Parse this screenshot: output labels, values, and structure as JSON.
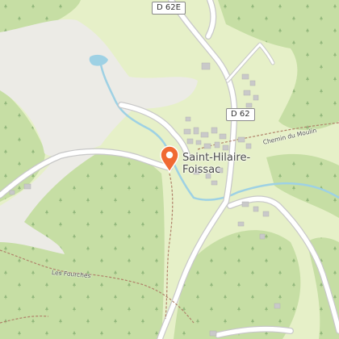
{
  "map": {
    "colors": {
      "forest": "#c6dea4",
      "meadow": "#e6f0c8",
      "open_area": "#ecebe6",
      "water": "#9ed1e4",
      "road_fill": "#ffffff",
      "road_casing": "#c8c8c8",
      "building": "#c9c9c9",
      "path": "#b0826a",
      "pin": "#f06a33"
    },
    "road_labels": {
      "d62e": "D 62E",
      "d62": "D 62"
    },
    "place_label": {
      "line1": "Saint-Hilaire-",
      "line2": "Foissac"
    },
    "path_labels": {
      "chemin": "Chemin du Moulin",
      "fourches": "Les Fourches"
    },
    "marker_icon": "map-pin-icon"
  }
}
